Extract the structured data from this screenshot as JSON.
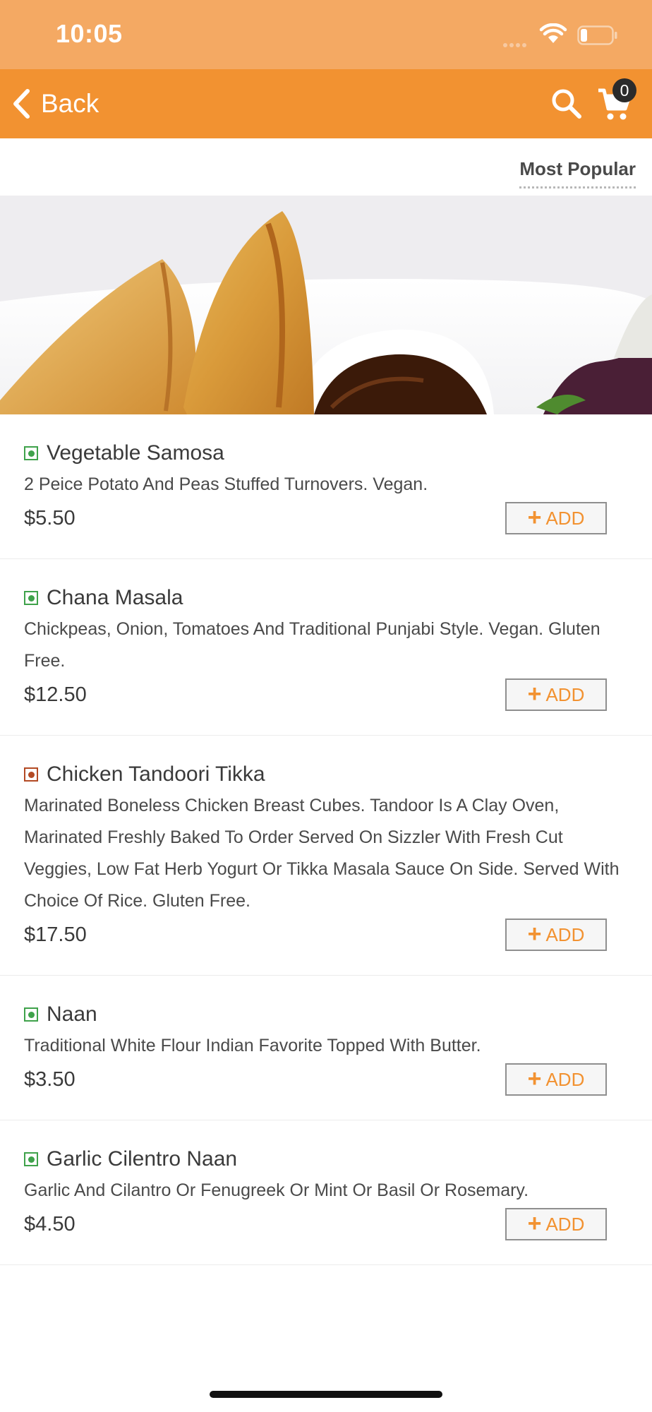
{
  "status_bar": {
    "time": "10:05"
  },
  "nav": {
    "back_label": "Back",
    "cart_count": "0"
  },
  "sort": {
    "label": "Most Popular"
  },
  "colors": {
    "accent": "#f29231",
    "status_bar": "#f4a963",
    "veg": "#3fa24b",
    "non_veg": "#b34a24"
  },
  "menu_items": [
    {
      "name": "Vegetable Samosa",
      "diet": "veg",
      "description": "2 Peice Potato And Peas Stuffed Turnovers. Vegan.",
      "price": "$5.50",
      "add_label": "ADD"
    },
    {
      "name": "Chana Masala",
      "diet": "veg",
      "description": "Chickpeas, Onion, Tomatoes And Traditional Punjabi Style. Vegan. Gluten Free.",
      "price": "$12.50",
      "add_label": "ADD"
    },
    {
      "name": "Chicken Tandoori Tikka",
      "diet": "non-veg",
      "description": "Marinated Boneless Chicken Breast Cubes. Tandoor Is A Clay Oven, Marinated Freshly Baked To Order Served On Sizzler With Fresh Cut Veggies, Low Fat Herb Yogurt Or Tikka Masala Sauce On Side. Served With Choice Of Rice. Gluten Free.",
      "price": "$17.50",
      "add_label": "ADD"
    },
    {
      "name": "Naan",
      "diet": "veg",
      "description": "Traditional White Flour Indian Favorite Topped With Butter.",
      "price": "$3.50",
      "add_label": "ADD"
    },
    {
      "name": "Garlic Cilentro Naan",
      "diet": "veg",
      "description": "Garlic And Cilantro Or Fenugreek Or Mint Or Basil Or Rosemary.",
      "price": "$4.50",
      "add_label": "ADD"
    }
  ]
}
